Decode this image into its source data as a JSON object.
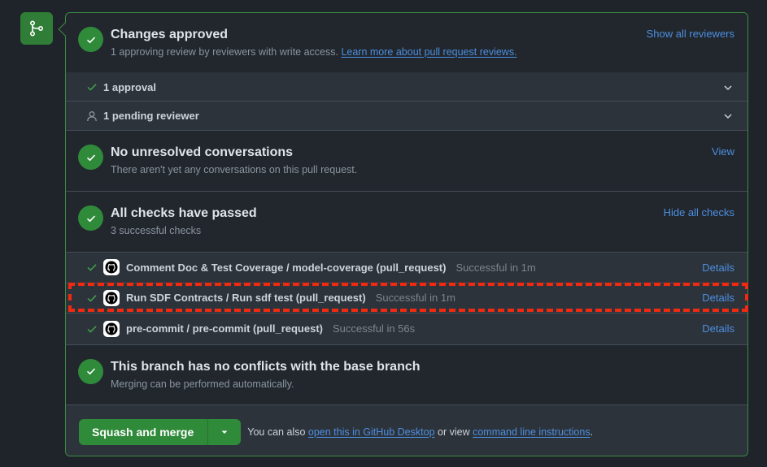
{
  "merge_box": {
    "review": {
      "title": "Changes approved",
      "desc_prefix": "1 approving review by reviewers with write access.",
      "desc_link": "Learn more about pull request reviews.",
      "action": "Show all reviewers",
      "rows": [
        {
          "label": "1 approval",
          "icon": "check-icon"
        },
        {
          "label": "1 pending reviewer",
          "icon": "person-icon"
        }
      ]
    },
    "conversations": {
      "title": "No unresolved conversations",
      "desc": "There aren't yet any conversations on this pull request.",
      "action": "View"
    },
    "checks": {
      "title": "All checks have passed",
      "desc": "3 successful checks",
      "action": "Hide all checks",
      "items": [
        {
          "name": "Comment Doc & Test Coverage / model-coverage (pull_request)",
          "status": "Successful in 1m",
          "details": "Details"
        },
        {
          "name": "Run SDF Contracts / Run sdf test (pull_request)",
          "status": "Successful in 1m",
          "details": "Details"
        },
        {
          "name": "pre-commit / pre-commit (pull_request)",
          "status": "Successful in 56s",
          "details": "Details"
        }
      ]
    },
    "conflicts": {
      "title": "This branch has no conflicts with the base branch",
      "desc": "Merging can be performed automatically."
    },
    "merge": {
      "button_label": "Squash and merge",
      "help_prefix": "You can also",
      "help_link1": "open this in GitHub Desktop",
      "help_mid": "or view",
      "help_link2": "command line instructions",
      "help_suffix": "."
    }
  },
  "colors": {
    "success": "#2f8a3a",
    "link": "#4c8fe0",
    "highlight": "#f02a10"
  }
}
